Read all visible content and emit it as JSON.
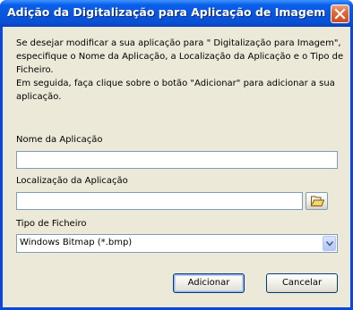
{
  "window": {
    "title": "Adição da Digitalização para Aplicação de Imagem"
  },
  "instructions": {
    "line1": "Se desejar modificar a sua aplicação para \" Digitalização para Imagem\",",
    "line2": "especifique o Nome da Aplicação, a Localização da Aplicação e o Tipo de",
    "line3": "Ficheiro.",
    "line4": "Em seguida, faça clique sobre o botão  \"Adicionar\" para adicionar a sua",
    "line5": "aplicação."
  },
  "form": {
    "app_name_label": "Nome da Aplicação",
    "app_name_value": "",
    "app_location_label": "Localização da Aplicação",
    "app_location_value": "",
    "file_type_label": "Tipo de Ficheiro",
    "file_type_value": "Windows Bitmap (*.bmp)"
  },
  "buttons": {
    "add_label": "Adicionar",
    "cancel_label": "Cancelar"
  },
  "icons": {
    "close": "close-icon",
    "browse": "folder-open-icon",
    "dropdown": "chevron-down-icon"
  },
  "colors": {
    "titlebar": "#0a5fea",
    "close_button": "#d04a1c",
    "client_background": "#ece9d8",
    "input_border": "#7f9db9"
  }
}
